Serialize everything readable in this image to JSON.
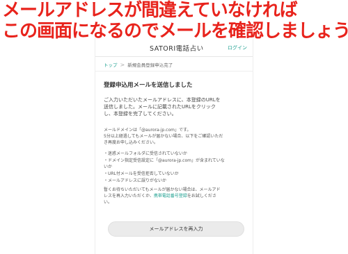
{
  "banner": {
    "line1": "メールアドレスが間違えていなければ",
    "line2": "この画面になるのでメールを確認しましょう"
  },
  "header": {
    "brand": "SATORI電話占い",
    "login": "ログイン"
  },
  "breadcrumb": {
    "home": "トップ",
    "separator": ">",
    "current": "新規会員登録申込完了"
  },
  "main": {
    "title": "登録申込用メールを送信しました",
    "intro": [
      "ご入力いただいたメールアドレスに、本登録のURLを",
      "送信しました。メールに記載されたURLをクリック",
      "し、本登録を完了してください。"
    ],
    "domain_note": [
      "メールドメインは「@aurora-jp.com」です。",
      "5分以上経過してもメールが届かない場合、以下をご確認いただ",
      "き再度お申し込みください。"
    ],
    "checklist": [
      "・迷惑メールフォルダに受信されていないか",
      "・ドメイン指定受信設定に「@aurora-jp.com」が含まれていな",
      "いか",
      "・URL付メールを受信拒否していないか",
      "・メールアドレスに誤りがないか"
    ],
    "retry_line1": "暫くお待ちいただいてもメールが届かない場合は、メールアド",
    "retry_line2_prefix": "レスを再入力いただくか、",
    "retry_link": "携帯電話番号登録",
    "retry_line2_suffix": "をお試しくださ",
    "retry_line3": "い。",
    "reenter_button": "メールアドレスを再入力"
  },
  "colors": {
    "banner_red": "#e8231c",
    "accent_teal": "#1a9e8e"
  }
}
